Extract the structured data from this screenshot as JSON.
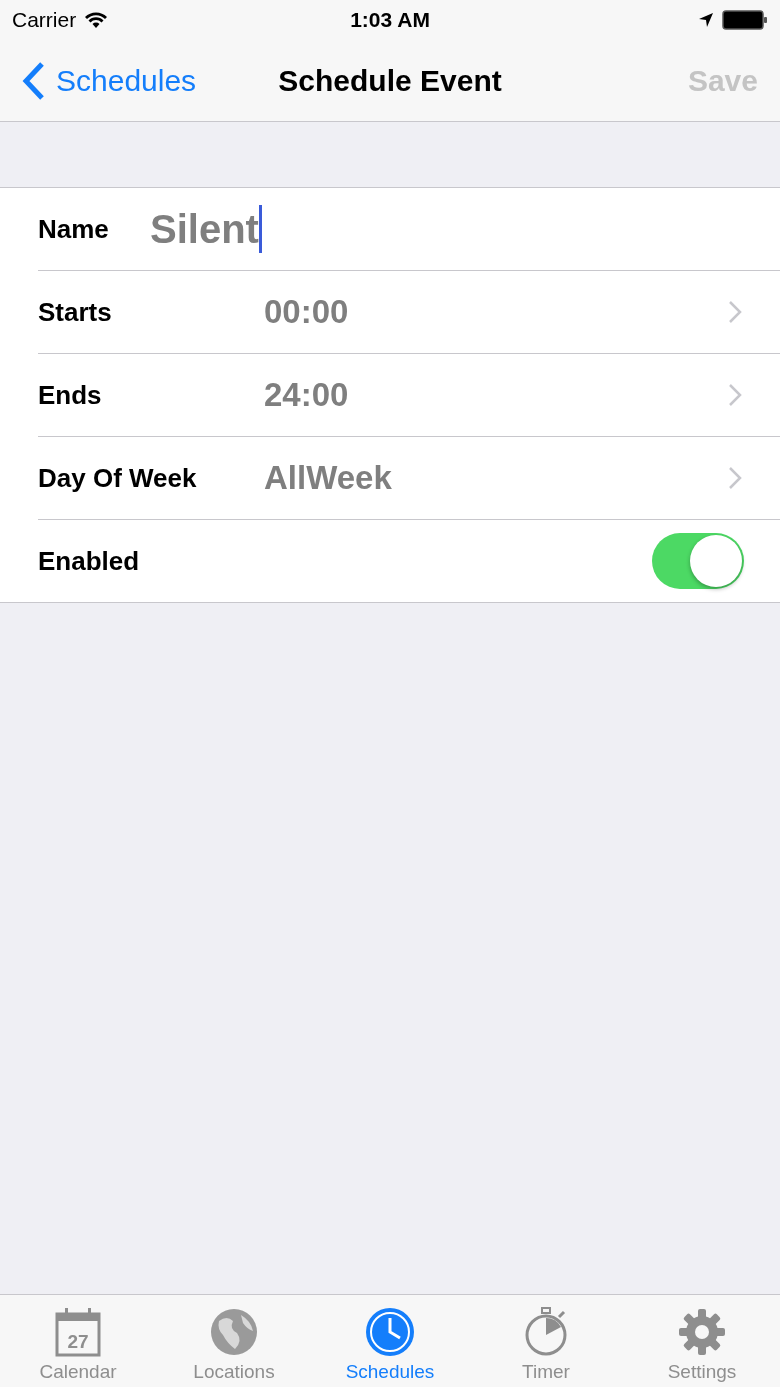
{
  "status_bar": {
    "carrier": "Carrier",
    "time": "1:03 AM"
  },
  "nav": {
    "back": "Schedules",
    "title": "Schedule Event",
    "save": {
      "label": "Save",
      "disabled": true
    }
  },
  "rows": [
    {
      "kind": "field",
      "label": "Name",
      "value": "Silent"
    },
    {
      "kind": "picker",
      "label": "Starts",
      "value": "00:00"
    },
    {
      "kind": "picker",
      "label": "Ends",
      "value": "24:00"
    },
    {
      "kind": "picker",
      "label": "Day Of Week",
      "value": "AllWeek"
    },
    {
      "kind": "toggle",
      "label": "Enabled",
      "on": true
    }
  ],
  "tabs": [
    {
      "kind": "calendar",
      "label": "Calendar",
      "day": "27",
      "selected": false
    },
    {
      "kind": "globe",
      "label": "Locations",
      "selected": false
    },
    {
      "kind": "clock",
      "label": "Schedules",
      "selected": true
    },
    {
      "kind": "timer",
      "label": "Timer",
      "selected": false
    },
    {
      "kind": "gear",
      "label": "Settings",
      "selected": false
    }
  ]
}
